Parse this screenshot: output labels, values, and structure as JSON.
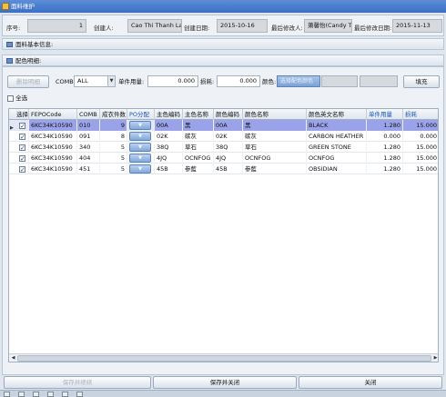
{
  "window": {
    "title": "面料维护"
  },
  "header": {
    "seq_label": "序号:",
    "seq_value": "1",
    "creator_label": "创建人:",
    "creator_value": "Cao Thi Thanh Lan(N",
    "create_date_label": "创建日期:",
    "create_date_value": "2015-10-16",
    "modifier_label": "最后修改人:",
    "modifier_value": "萧馨怡(Candy Tang)",
    "modify_date_label": "最后修改日期:",
    "modify_date_value": "2015-11-13"
  },
  "sections": {
    "basic": "面料基本信息:",
    "color": "配色明细:"
  },
  "toolbar": {
    "delete_label": "删除明细",
    "comb_label": "COMB:",
    "comb_value": "ALL",
    "unit_usage_label": "单件用量:",
    "unit_usage_value": "0.000",
    "loss_label": "损耗:",
    "loss_value": "0.000",
    "color_label": "颜色:",
    "color_select_label": "选择配色颜色",
    "fill_label": "填充"
  },
  "select_all_label": "全选",
  "grid": {
    "columns": [
      "选择",
      "FEPOCode",
      "COMB",
      "成衣件数",
      "PO分配",
      "主色编码",
      "主色名称",
      "颜色编码",
      "颜色名称",
      "颜色英文名称",
      "单件用量",
      "损耗"
    ],
    "po_button_label": "▼",
    "rows": [
      {
        "checked": true,
        "fepo": "6KC34K10590",
        "comb": "010",
        "qty": "9",
        "main_code": "00A",
        "main_name": "黑",
        "color_code": "00A",
        "color_name": "黑",
        "color_en": "BLACK",
        "usage": "1.280",
        "loss": "15.000"
      },
      {
        "checked": true,
        "fepo": "6KC34K10590",
        "comb": "091",
        "qty": "8",
        "main_code": "02K",
        "main_name": "碳灰",
        "color_code": "02K",
        "color_name": "碳灰",
        "color_en": "CARBON HEATHER",
        "usage": "0.000",
        "loss": "0.000"
      },
      {
        "checked": true,
        "fepo": "6KC34K10590",
        "comb": "340",
        "qty": "5",
        "main_code": "38Q",
        "main_name": "草石",
        "color_code": "38Q",
        "color_name": "草石",
        "color_en": "GREEN STONE",
        "usage": "1.280",
        "loss": "15.000"
      },
      {
        "checked": true,
        "fepo": "6KC34K10590",
        "comb": "404",
        "qty": "5",
        "main_code": "4JQ",
        "main_name": "OCNFOG",
        "color_code": "4JQ",
        "color_name": "OCNFOG",
        "color_en": "OCNFOG",
        "usage": "1.280",
        "loss": "15.000"
      },
      {
        "checked": true,
        "fepo": "6KC34K10590",
        "comb": "451",
        "qty": "5",
        "main_code": "45B",
        "main_name": "参藍",
        "color_code": "45B",
        "color_name": "参藍",
        "color_en": "OBSIDIAN",
        "usage": "1.280",
        "loss": "15.000"
      }
    ]
  },
  "footer": {
    "save_label": "保存并继续",
    "save_close_label": "保存并关闭",
    "close_label": "关闭"
  }
}
